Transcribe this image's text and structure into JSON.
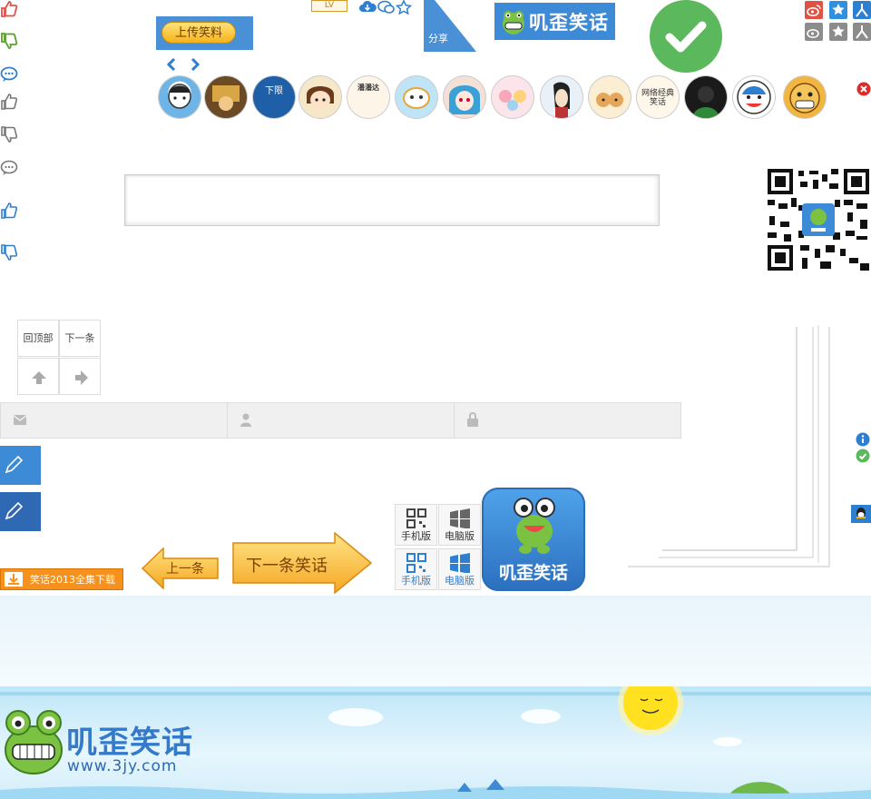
{
  "header": {
    "upload_label": "上传笑料",
    "lv_badge": "LV",
    "share_label": "分享",
    "logo_text": "叽歪笑话"
  },
  "avatars": [
    {
      "name": "avatar-1",
      "text": ""
    },
    {
      "name": "avatar-2",
      "text": ""
    },
    {
      "name": "avatar-3",
      "text": "下限"
    },
    {
      "name": "avatar-4",
      "text": ""
    },
    {
      "name": "avatar-5",
      "text": "潘潘达"
    },
    {
      "name": "avatar-6",
      "text": ""
    },
    {
      "name": "avatar-7",
      "text": ""
    },
    {
      "name": "avatar-8",
      "text": ""
    },
    {
      "name": "avatar-9",
      "text": ""
    },
    {
      "name": "avatar-10",
      "text": ""
    },
    {
      "name": "avatar-11",
      "text": "网络经典笑话"
    },
    {
      "name": "avatar-12",
      "text": ""
    },
    {
      "name": "avatar-13",
      "text": ""
    },
    {
      "name": "avatar-14",
      "text": ""
    }
  ],
  "nav": {
    "top_label": "回顶部",
    "next_label": "下一条"
  },
  "buttons": {
    "download_label": "笑话2013全集下载",
    "prev_label": "上一条",
    "next_joke_label": "下一条笑话"
  },
  "versions": {
    "mobile_label": "手机版",
    "pc_label": "电脑版"
  },
  "app_icon_text": "叽歪笑话",
  "footer": {
    "logo_text": "叽歪笑话",
    "url": "www.3jy.com"
  },
  "colors": {
    "brand_blue": "#3d8ad6",
    "vote_red": "#e0524a",
    "vote_green": "#5aa02c",
    "check_green": "#5cb85c",
    "download_orange": "#f6911e"
  }
}
